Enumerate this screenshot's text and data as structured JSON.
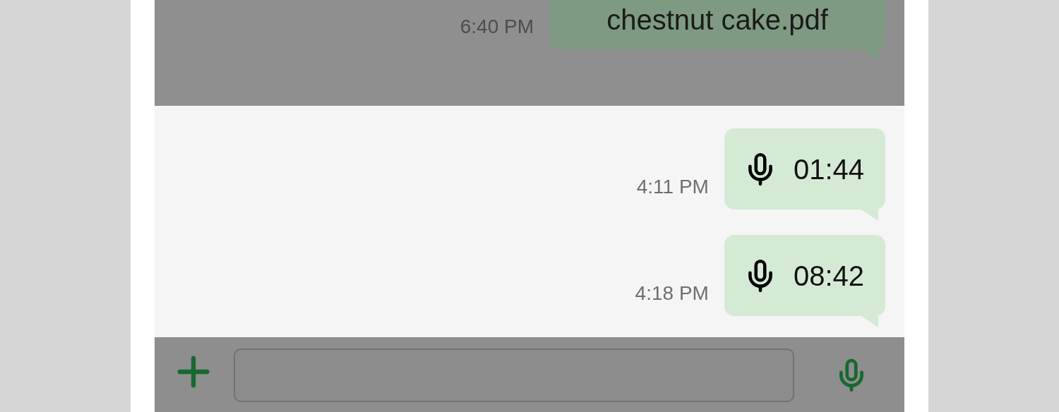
{
  "messages": [
    {
      "kind": "file",
      "text": "chestnut cake.pdf",
      "time": "6:40 PM",
      "dimmed": true
    },
    {
      "kind": "voice",
      "duration": "01:44",
      "time": "4:11 PM",
      "dimmed": false
    },
    {
      "kind": "voice",
      "duration": "08:42",
      "time": "4:18 PM",
      "dimmed": false
    }
  ],
  "composer": {
    "dimmed": true
  }
}
